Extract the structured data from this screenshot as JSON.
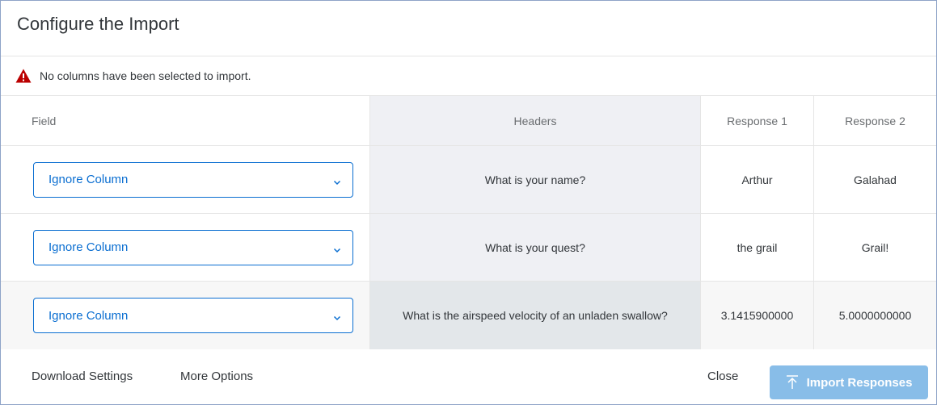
{
  "dialog": {
    "title": "Configure the Import"
  },
  "message": {
    "icon": "warning-icon",
    "text": "No columns have been selected to import.",
    "color": "#bb0000"
  },
  "table": {
    "columns": [
      "Field",
      "Headers",
      "Response 1",
      "Response 2"
    ],
    "rows": [
      {
        "field": "Ignore Column",
        "header": "What is your name?",
        "response1": "Arthur",
        "response2": "Galahad"
      },
      {
        "field": "Ignore Column",
        "header": "What is your quest?",
        "response1": "the grail",
        "response2": "Grail!"
      },
      {
        "field": "Ignore Column",
        "header": "What is the airspeed velocity of an unladen swallow?",
        "response1": "3.1415900000",
        "response2": "5.0000000000"
      }
    ]
  },
  "footer": {
    "download_label": "Download Settings",
    "more_label": "More Options",
    "close_label": "Close",
    "import_label": "Import Responses",
    "import_icon": "upload-icon",
    "accent": "#0a6ed1"
  }
}
